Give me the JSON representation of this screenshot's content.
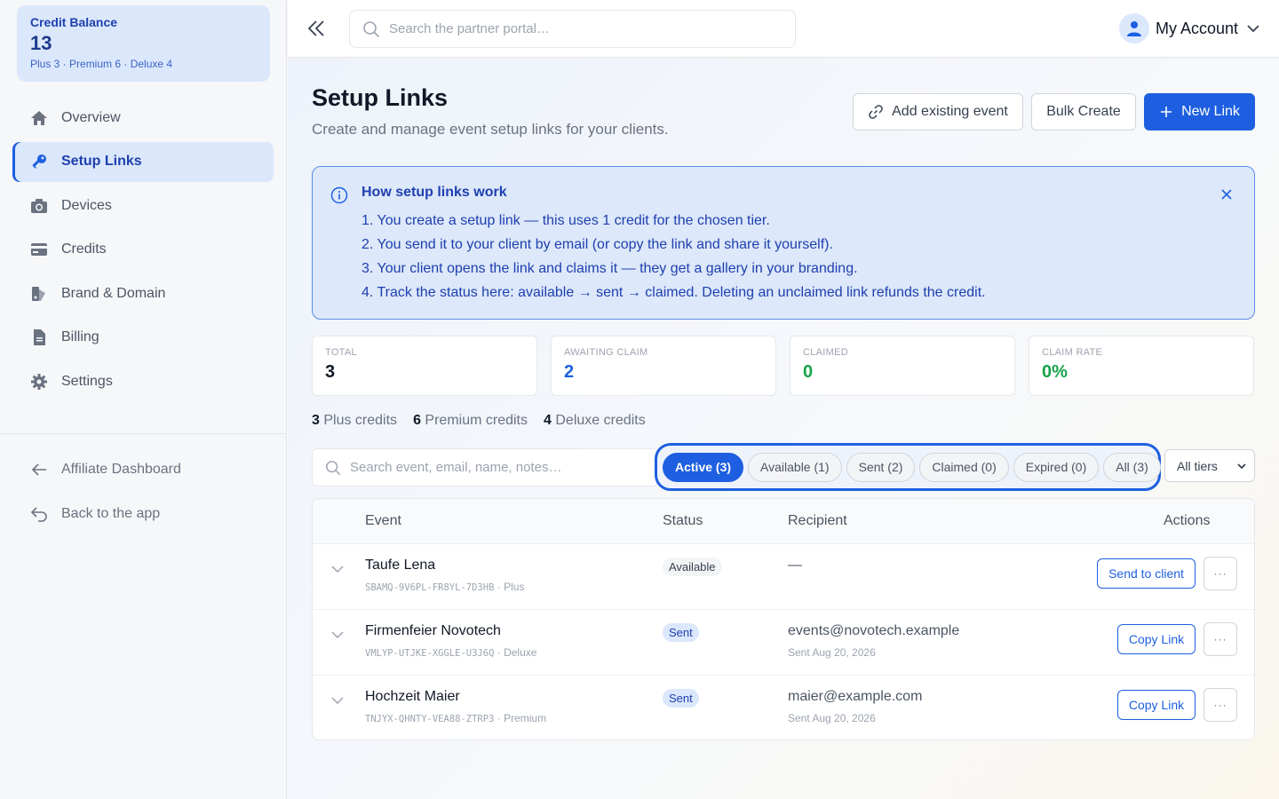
{
  "sidebar": {
    "credit_balance": {
      "label": "Credit Balance",
      "value": "13",
      "detail": "Plus 3 · Premium 6 · Deluxe 4"
    },
    "nav": [
      {
        "label": "Overview",
        "icon": "home-icon"
      },
      {
        "label": "Setup Links",
        "icon": "key-icon",
        "active": true
      },
      {
        "label": "Devices",
        "icon": "camera-icon"
      },
      {
        "label": "Credits",
        "icon": "credit-card-icon"
      },
      {
        "label": "Brand & Domain",
        "icon": "brand-icon"
      },
      {
        "label": "Billing",
        "icon": "document-icon"
      },
      {
        "label": "Settings",
        "icon": "gear-icon"
      }
    ],
    "secondary": [
      {
        "label": "Affiliate Dashboard",
        "icon": "arrow-left-icon"
      },
      {
        "label": "Back to the app",
        "icon": "return-icon"
      }
    ]
  },
  "topbar": {
    "search_placeholder": "Search the partner portal…",
    "account_label": "My Account"
  },
  "page": {
    "title": "Setup Links",
    "subtitle": "Create and manage event setup links for your clients.",
    "buttons": {
      "add_existing": "Add existing event",
      "bulk_create": "Bulk Create",
      "new_link": "New Link"
    }
  },
  "info": {
    "title": "How setup links work",
    "steps": [
      "1. You create a setup link — this uses 1 credit for the chosen tier.",
      "2. You send it to your client by email (or copy the link and share it yourself).",
      "3. Your client opens the link and claims it — they get a gallery in your branding.",
      "4. Track the status here: available → sent → claimed. Deleting an unclaimed link refunds the credit."
    ]
  },
  "stats": [
    {
      "label": "TOTAL",
      "value": "3",
      "color": "#111827"
    },
    {
      "label": "AWAITING CLAIM",
      "value": "2",
      "color": "#1d5fe0"
    },
    {
      "label": "CLAIMED",
      "value": "0",
      "color": "#16a34a"
    },
    {
      "label": "CLAIM RATE",
      "value": "0%",
      "color": "#16a34a"
    }
  ],
  "tiers": [
    {
      "count": "3",
      "label": "Plus credits"
    },
    {
      "count": "6",
      "label": "Premium credits"
    },
    {
      "count": "4",
      "label": "Deluxe credits"
    }
  ],
  "filters": {
    "search_placeholder": "Search event, email, name, notes…",
    "pills": [
      "Active (3)",
      "Available (1)",
      "Sent (2)",
      "Claimed (0)",
      "Expired (0)",
      "All (3)"
    ],
    "active_pill": "Active (3)",
    "tier_select": "All tiers"
  },
  "table": {
    "headers": {
      "event": "Event",
      "status": "Status",
      "recipient": "Recipient",
      "actions": "Actions"
    },
    "rows": [
      {
        "name": "Taufe Lena",
        "code": "SBAMQ-9V6PL-FR8YL-7D3HB",
        "tier": "Plus",
        "status": "Available",
        "recipient": "—",
        "sent": "",
        "action": "Send to client"
      },
      {
        "name": "Firmenfeier Novotech",
        "code": "VMLYP-UTJKE-XGGLE-U3J6Q",
        "tier": "Deluxe",
        "status": "Sent",
        "recipient": "events@novotech.example",
        "sent": "Sent Aug 20, 2026",
        "action": "Copy Link"
      },
      {
        "name": "Hochzeit Maier",
        "code": "TNJYX-QHNTY-VEA88-ZTRP3",
        "tier": "Premium",
        "status": "Sent",
        "recipient": "maier@example.com",
        "sent": "Sent Aug 20, 2026",
        "action": "Copy Link"
      }
    ],
    "meta_separator": "·",
    "more_label": "···"
  },
  "colors": {
    "accent": "#1d5fe0",
    "success": "#16a34a"
  }
}
